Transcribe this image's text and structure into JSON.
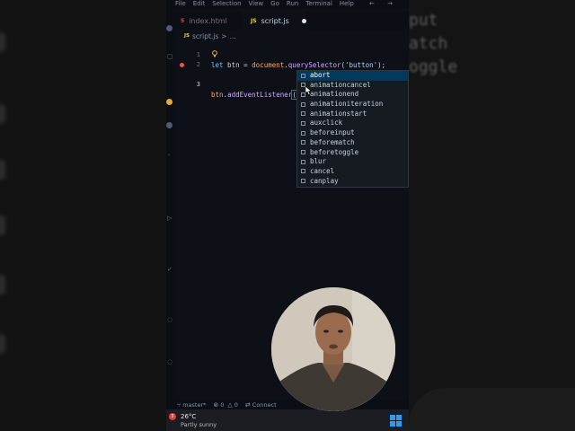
{
  "menu": [
    "File",
    "Edit",
    "Selection",
    "View",
    "Go",
    "Run",
    "Terminal",
    "Help"
  ],
  "nav_arrows": "← →",
  "tabs": [
    {
      "label": "index.html",
      "icon": "5",
      "active": false
    },
    {
      "label": "script.js",
      "icon": "JS",
      "active": true,
      "modified": true
    }
  ],
  "breadcrumb": {
    "icon": "JS",
    "file": "script.js",
    "sep": ">",
    "rest": "..."
  },
  "code": {
    "line1": {
      "num": "1",
      "kw": "let",
      "var": " btn",
      "eq": " = ",
      "obj": "document",
      "dot": ".",
      "fn": "querySelector",
      "open": "(",
      "str": "'button'",
      "close": ");"
    },
    "line2": {
      "num": "2"
    },
    "line3": {
      "num": "3",
      "obj": "btn",
      "dot": ".",
      "fn": "addEventListener",
      "open": "(",
      "str": "\"\"",
      "close": ")"
    }
  },
  "suggestions": [
    "abort",
    "animationcancel",
    "animationend",
    "animationiteration",
    "animationstart",
    "auxclick",
    "beforeinput",
    "beforematch",
    "beforetoggle",
    "blur",
    "cancel",
    "canplay"
  ],
  "selected_suggestion": 0,
  "status": {
    "branch": "master*",
    "errors": "0",
    "warnings": "0",
    "connect": "Connect"
  },
  "weather": {
    "badge": "3",
    "temp": "26°C",
    "desc": "Partly sunny"
  },
  "right_ghost_text": [
    "put",
    "atch",
    "oggle"
  ],
  "colors": {
    "accent": "#04395e",
    "windows": "#2f9bf0",
    "breakpoint": "#f85149"
  }
}
